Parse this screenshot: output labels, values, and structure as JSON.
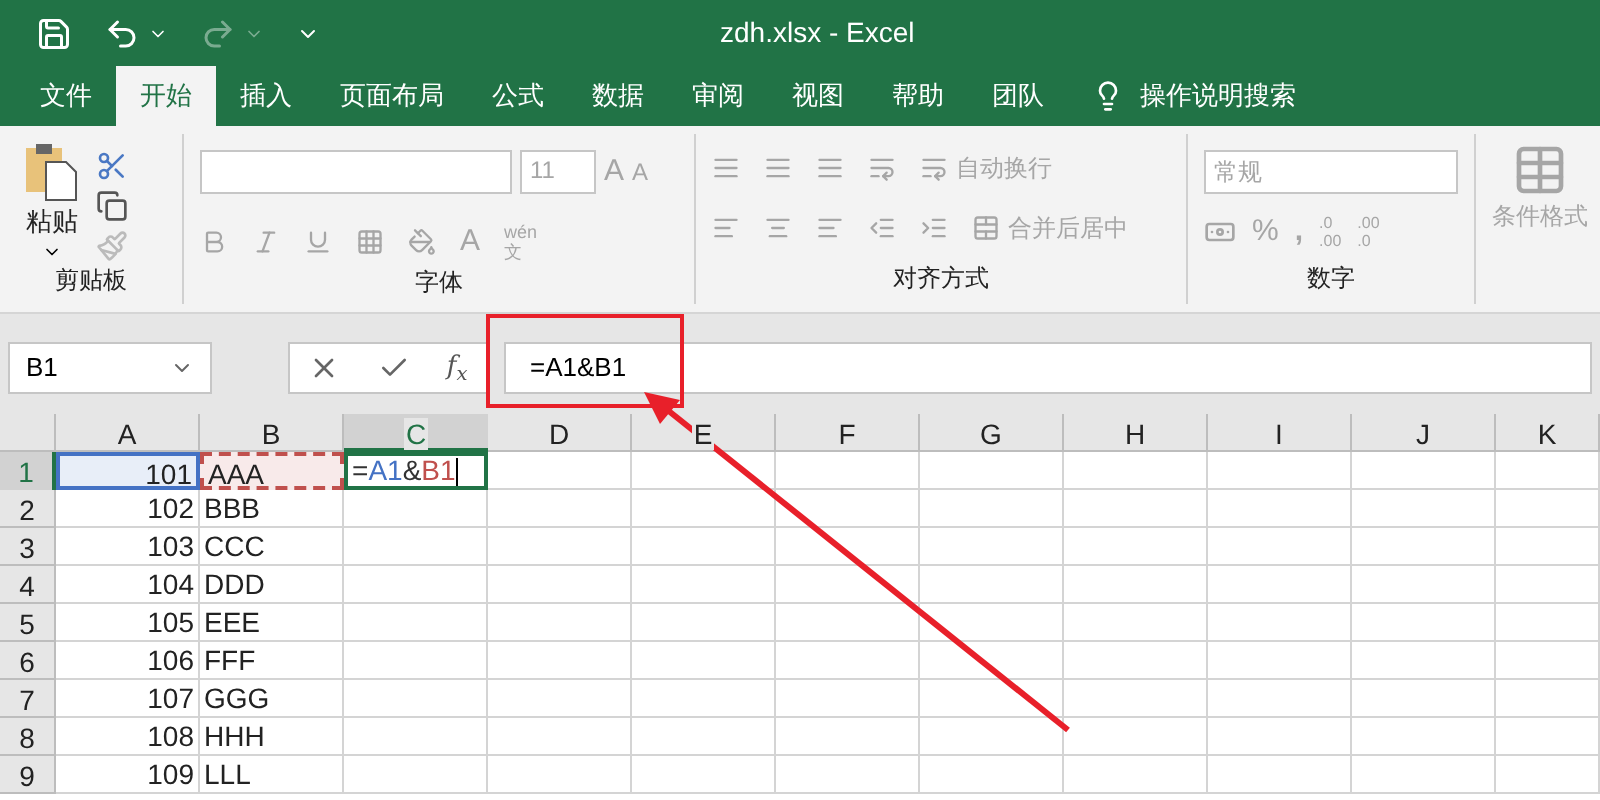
{
  "window": {
    "title": "zdh.xlsx  -  Excel"
  },
  "tabs": [
    {
      "label": "文件",
      "selected": false
    },
    {
      "label": "开始",
      "selected": true
    },
    {
      "label": "插入",
      "selected": false
    },
    {
      "label": "页面布局",
      "selected": false
    },
    {
      "label": "公式",
      "selected": false
    },
    {
      "label": "数据",
      "selected": false
    },
    {
      "label": "审阅",
      "selected": false
    },
    {
      "label": "视图",
      "selected": false
    },
    {
      "label": "帮助",
      "selected": false
    },
    {
      "label": "团队",
      "selected": false
    }
  ],
  "search_hint": "操作说明搜索",
  "ribbon": {
    "disabled": true,
    "clipboard": {
      "paste": "粘贴",
      "group": "剪贴板"
    },
    "font": {
      "size": "11",
      "grow": "A",
      "shrink": "A",
      "font_color_button": "A",
      "phonetic_top": "wén",
      "phonetic_bottom": "文",
      "group": "字体"
    },
    "alignment": {
      "wrap": "自动换行",
      "merge": "合并后居中",
      "group": "对齐方式"
    },
    "number": {
      "format": "常规",
      "percent": "%",
      "comma": ",",
      "increase_decimal": [
        ".0",
        ".00"
      ],
      "decrease_decimal": [
        ".00",
        ".0"
      ],
      "group": "数字"
    },
    "styles": {
      "conditional": "条件格式"
    }
  },
  "formula_bar": {
    "name_box": "B1",
    "function_button": "f$_{x}$",
    "formula": "=A1&B1"
  },
  "columns": [
    {
      "label": "A",
      "selected": false
    },
    {
      "label": "B",
      "selected": false
    },
    {
      "label": "C",
      "selected": true
    },
    {
      "label": "D",
      "selected": false
    },
    {
      "label": "E",
      "selected": false
    },
    {
      "label": "F",
      "selected": false
    },
    {
      "label": "G",
      "selected": false
    },
    {
      "label": "H",
      "selected": false
    },
    {
      "label": "I",
      "selected": false
    },
    {
      "label": "J",
      "selected": false
    },
    {
      "label": "K",
      "selected": false
    }
  ],
  "rows": [
    {
      "label": "1",
      "selected": true,
      "a": "101",
      "b": "AAA",
      "references": [
        {
          "color": "#4472c4"
        },
        {
          "color": "#c0504d"
        }
      ]
    },
    {
      "label": "2",
      "selected": false,
      "a": "102",
      "b": "BBB"
    },
    {
      "label": "3",
      "selected": false,
      "a": "103",
      "b": "CCC"
    },
    {
      "label": "4",
      "selected": false,
      "a": "104",
      "b": "DDD"
    },
    {
      "label": "5",
      "selected": false,
      "a": "105",
      "b": "EEE"
    },
    {
      "label": "6",
      "selected": false,
      "a": "106",
      "b": "FFF"
    },
    {
      "label": "7",
      "selected": false,
      "a": "107",
      "b": "GGG"
    },
    {
      "label": "8",
      "selected": false,
      "a": "108",
      "b": "HHH"
    },
    {
      "label": "9",
      "selected": false,
      "a": "109",
      "b": "LLL"
    }
  ],
  "editing_cell": {
    "parts": [
      {
        "text": "=",
        "color": "#333333"
      },
      {
        "text": "A1",
        "color": "#4472c4"
      },
      {
        "text": "&",
        "color": "#333333"
      },
      {
        "text": "B1",
        "color": "#c0504d"
      }
    ]
  }
}
